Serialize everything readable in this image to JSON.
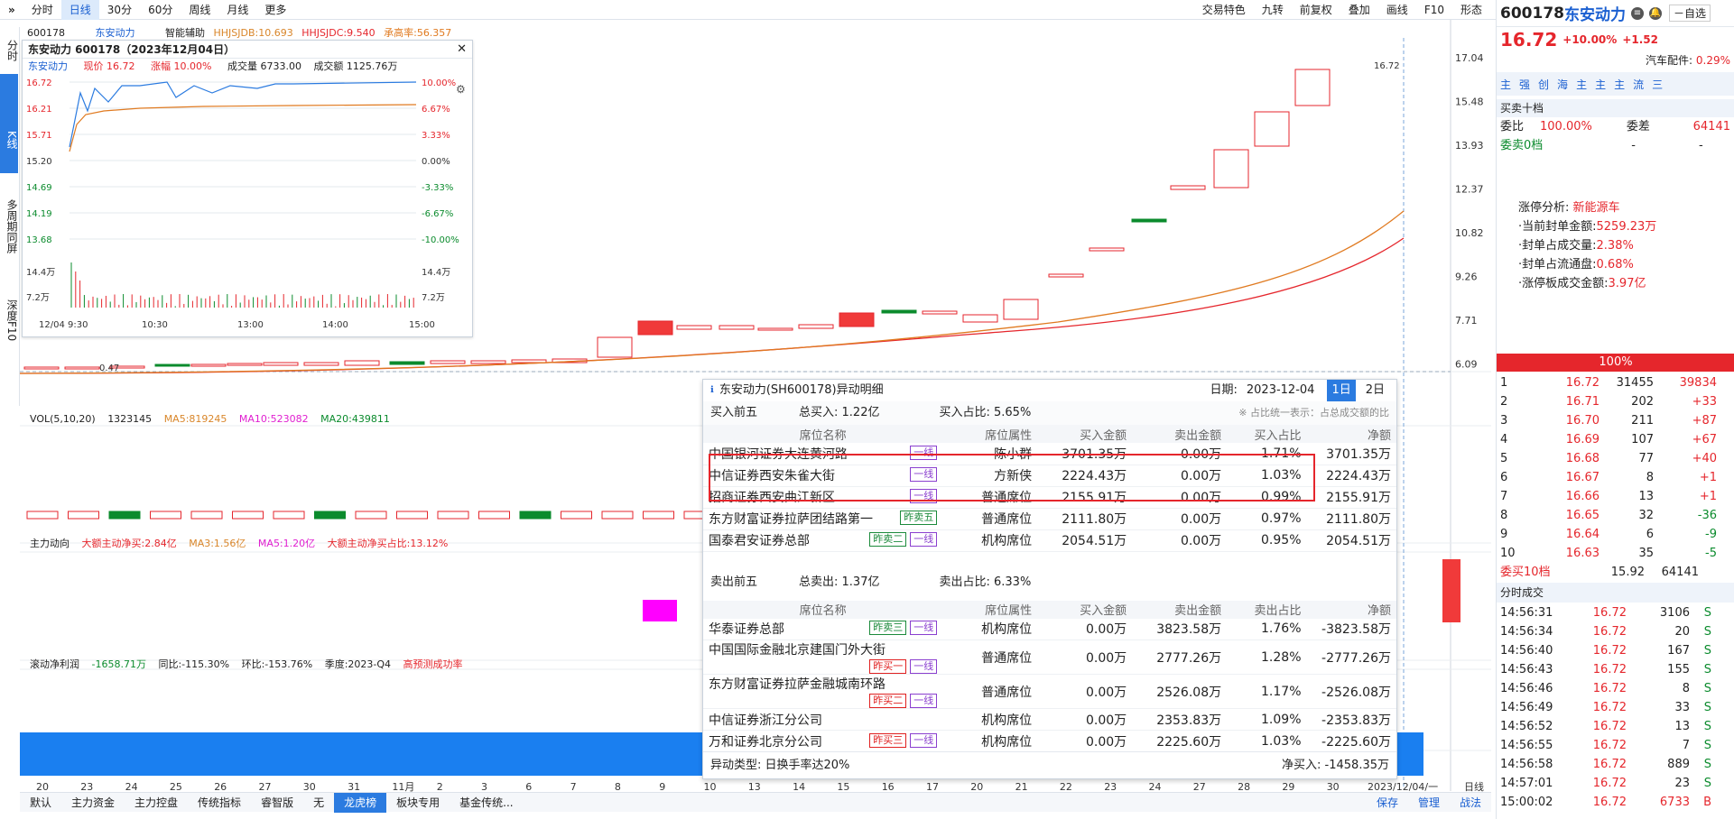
{
  "topbar": {
    "collapse": "»",
    "code": "600178",
    "tabs": [
      {
        "label": "分时"
      },
      {
        "label": "日线",
        "active": true
      },
      {
        "label": "30分"
      },
      {
        "label": "60分"
      },
      {
        "label": "周线"
      },
      {
        "label": "月线"
      },
      {
        "label": "更多"
      }
    ],
    "right": [
      {
        "label": "交易特色"
      },
      {
        "label": "九转"
      },
      {
        "label": "前复权"
      },
      {
        "label": "叠加"
      },
      {
        "label": "画线"
      },
      {
        "label": "F10"
      },
      {
        "label": "形态"
      }
    ]
  },
  "nav": [
    "分时",
    "K线",
    "多周期同屏",
    "深度F10"
  ],
  "infoline": {
    "code": "600178",
    "name": "东安动力",
    "assist": "智能辅助",
    "i1": "HHJSJDB:10.693",
    "i2": "HHJSJDC:9.540",
    "i3": "承高率:56.357"
  },
  "mini": {
    "title": "东安动力 600178（2023年12月04日）",
    "name": "东安动力",
    "price": "现价 16.72",
    "chg": "涨幅 10.00%",
    "vol": "成交量 6733.00",
    "amt": "成交额 1125.76万",
    "yl": [
      "16.72",
      "16.21",
      "15.71",
      "15.20",
      "14.69",
      "14.19",
      "13.68",
      "14.4万",
      "7.2万"
    ],
    "yr": [
      "10.00%",
      "6.67%",
      "3.33%",
      "0.00%",
      "-3.33%",
      "-6.67%",
      "-10.00%",
      "14.4万",
      "7.2万"
    ],
    "xl": [
      "12/04 9:30",
      "10:30",
      "13:00",
      "14:00",
      "15:00"
    ]
  },
  "yaxis": [
    "17.04",
    "15.48",
    "13.93",
    "12.37",
    "10.82",
    "9.26",
    "7.71",
    "6.09"
  ],
  "peak": "16.72",
  "low": "0.47",
  "vol": {
    "label": "VOL(5,10,20)",
    "v": "1323145",
    "ma5": "MA5:819245",
    "ma10": "MA10:523082",
    "ma20": "MA20:439811"
  },
  "zl": {
    "label": "主力动向",
    "a": "大额主动净买:2.84亿",
    "b": "MA3:1.56亿",
    "c": "MA5:1.20亿",
    "d": "大额主动净买占比:13.12%"
  },
  "lr": {
    "label": "滚动净利润",
    "a": "-1658.71万",
    "b": "同比:-115.30%",
    "c": "环比:-153.76%",
    "d": "季度:2023-Q4",
    "e": "高预测成功率"
  },
  "xaxis": [
    "20",
    "23",
    "24",
    "25",
    "26",
    "27",
    "30",
    "31",
    "11月",
    "2",
    "3",
    "6",
    "7",
    "8",
    "9",
    "10",
    "13",
    "14",
    "15",
    "16",
    "17",
    "20",
    "21",
    "22",
    "23",
    "24",
    "27",
    "28",
    "29",
    "30",
    "2023/12/04/一",
    "日线"
  ],
  "lhb": {
    "title": "东安动力(SH600178)异动明细",
    "date_label": "日期:",
    "date": "2023-12-04",
    "d1": "1日",
    "d2": "2日",
    "buy": {
      "h": "买入前五",
      "total": "总买入: 1.22亿",
      "ratio": "买入占比: 5.65%",
      "note": "※ 占比统一表示：占总成交额的比"
    },
    "cols": [
      "席位名称",
      "席位属性",
      "买入金额",
      "卖出金额",
      "买入占比",
      "净额"
    ],
    "scols": [
      "席位名称",
      "席位属性",
      "买入金额",
      "卖出金额",
      "卖出占比",
      "净额"
    ],
    "buyrows": [
      {
        "n": "中国银河证券大连黄河路",
        "t": [
          "一线"
        ],
        "a": "陈小群",
        "b": "3701.35万",
        "s": "0.00万",
        "r": "1.71%",
        "net": "3701.35万"
      },
      {
        "n": "中信证券西安朱雀大街",
        "t": [
          "一线"
        ],
        "a": "方新侠",
        "b": "2224.43万",
        "s": "0.00万",
        "r": "1.03%",
        "net": "2224.43万"
      },
      {
        "n": "招商证券西安曲江新区",
        "t": [
          "一线"
        ],
        "a": "普通席位",
        "b": "2155.91万",
        "s": "0.00万",
        "r": "0.99%",
        "net": "2155.91万"
      },
      {
        "n": "东方财富证券拉萨团结路第一",
        "t": [
          "昨卖五"
        ],
        "a": "普通席位",
        "b": "2111.80万",
        "s": "0.00万",
        "r": "0.97%",
        "net": "2111.80万"
      },
      {
        "n": "国泰君安证券总部",
        "t": [
          "昨卖二",
          "一线"
        ],
        "a": "机构席位",
        "b": "2054.51万",
        "s": "0.00万",
        "r": "0.95%",
        "net": "2054.51万"
      }
    ],
    "sell": {
      "h": "卖出前五",
      "total": "总卖出: 1.37亿",
      "ratio": "卖出占比: 6.33%"
    },
    "sellrows": [
      {
        "n": "华泰证券总部",
        "t": [
          "昨卖三",
          "一线"
        ],
        "a": "机构席位",
        "b": "0.00万",
        "s": "3823.58万",
        "r": "1.76%",
        "net": "-3823.58万"
      },
      {
        "n": "中国国际金融北京建国门外大街",
        "t": [
          "昨买一",
          "一线"
        ],
        "a": "普通席位",
        "b": "0.00万",
        "s": "2777.26万",
        "r": "1.28%",
        "net": "-2777.26万"
      },
      {
        "n": "东方财富证券拉萨金融城南环路",
        "t": [
          "昨买二",
          "一线"
        ],
        "a": "普通席位",
        "b": "0.00万",
        "s": "2526.08万",
        "r": "1.17%",
        "net": "-2526.08万"
      },
      {
        "n": "中信证券浙江分公司",
        "t": [],
        "a": "机构席位",
        "b": "0.00万",
        "s": "2353.83万",
        "r": "1.09%",
        "net": "-2353.83万"
      },
      {
        "n": "万和证券北京分公司",
        "t": [
          "昨买三",
          "一线"
        ],
        "a": "机构席位",
        "b": "0.00万",
        "s": "2225.60万",
        "r": "1.03%",
        "net": "-2225.60万"
      }
    ],
    "type": "异动类型: 日换手率达20%",
    "net": "净买入: -1458.35万"
  },
  "rp": {
    "code": "600178",
    "name": "东安动力",
    "self": "自选",
    "price": "16.72",
    "pct": "+10.00%",
    "chg": "+1.52",
    "sector": "汽车配件:",
    "spct": "0.29%",
    "chips": [
      "主",
      "强",
      "创",
      "海",
      "主",
      "主",
      "主",
      "流",
      "三"
    ],
    "mm": "买卖十档",
    "wb": "委比",
    "wbv": "100.00%",
    "wc": "委差",
    "wcv": "64141",
    "wm": "委卖0档",
    "d1": "-",
    "d2": "-",
    "zt": "涨停分析:",
    "ztv": "新能源车",
    "f1": "·当前封单金额:",
    "f1v": "5259.23万",
    "f2": "·封单占成交量:",
    "f2v": "2.38%",
    "f3": "·封单占流通盘:",
    "f3v": "0.68%",
    "f4": "·涨停板成交金额:",
    "f4v": "3.97亿",
    "bar": "100%",
    "bids": [
      [
        "1",
        "16.72",
        "31455",
        "39834"
      ],
      [
        "2",
        "16.71",
        "202",
        "+33"
      ],
      [
        "3",
        "16.70",
        "211",
        "+87"
      ],
      [
        "4",
        "16.69",
        "107",
        "+67"
      ],
      [
        "5",
        "16.68",
        "77",
        "+40"
      ],
      [
        "6",
        "16.67",
        "8",
        "+1"
      ],
      [
        "7",
        "16.66",
        "13",
        "+1"
      ],
      [
        "8",
        "16.65",
        "32",
        "-36"
      ],
      [
        "9",
        "16.64",
        "6",
        "-9"
      ],
      [
        "10",
        "16.63",
        "35",
        "-5"
      ]
    ],
    "bidtot": [
      "委买10档",
      "15.92",
      "64141"
    ],
    "ticks_h": "分时成交",
    "ticks": [
      [
        "14:56:31",
        "16.72",
        "3106",
        "S"
      ],
      [
        "14:56:34",
        "16.72",
        "20",
        "S"
      ],
      [
        "14:56:40",
        "16.72",
        "167",
        "S"
      ],
      [
        "14:56:43",
        "16.72",
        "155",
        "S"
      ],
      [
        "14:56:46",
        "16.72",
        "8",
        "S"
      ],
      [
        "14:56:49",
        "16.72",
        "33",
        "S"
      ],
      [
        "14:56:52",
        "16.72",
        "13",
        "S"
      ],
      [
        "14:56:55",
        "16.72",
        "7",
        "S"
      ],
      [
        "14:56:58",
        "16.72",
        "889",
        "S"
      ],
      [
        "14:57:01",
        "16.72",
        "23",
        "S"
      ],
      [
        "15:00:02",
        "16.72",
        "6733",
        "B"
      ]
    ]
  },
  "bottom": {
    "tabs": [
      "默认",
      "主力资金",
      "主力控盘",
      "传统指标",
      "睿智版",
      "无",
      "龙虎榜",
      "板块专用",
      "基金传统..."
    ],
    "active": 6,
    "right": [
      "保存",
      "管理",
      "战法"
    ]
  }
}
